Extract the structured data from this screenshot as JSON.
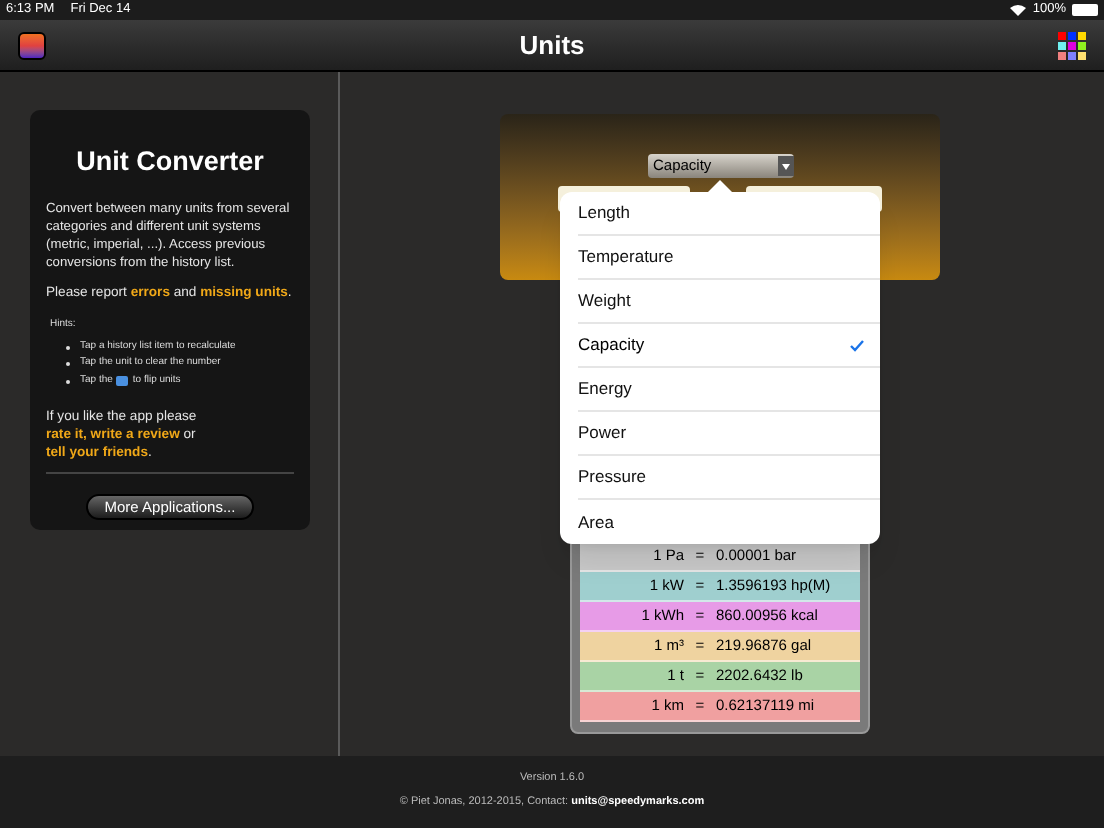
{
  "status_bar": {
    "time": "6:13 PM",
    "date": "Fri Dec 14",
    "battery": "100%"
  },
  "nav_bar": {
    "title": "Units"
  },
  "info_card": {
    "title": "Unit Converter",
    "intro": "Convert between many units from several categories and different unit systems (metric, imperial, ...). Access previous conversions from the history list.",
    "report": [
      {
        "kind": "text",
        "text": "Please report"
      },
      {
        "kind": "link",
        "text": "errors"
      },
      {
        "kind": "text",
        "text": "and"
      },
      {
        "kind": "link",
        "text": "missing units"
      },
      {
        "kind": "text",
        "text": "."
      }
    ],
    "hints_title": "Hints:",
    "hints": [
      {
        "kind": "text",
        "text": "Tap a history list item to recalculate"
      },
      {
        "kind": "text",
        "text": "Tap the unit to clear the number"
      },
      {
        "kind": "with-icon",
        "text": "Tap the",
        "text_after": "to flip units"
      }
    ],
    "rate": [
      {
        "kind": "text",
        "text": "If you like the app please"
      },
      {
        "kind": "link",
        "text": "rate it, write a review"
      },
      {
        "kind": "text",
        "text": "or"
      },
      {
        "kind": "link",
        "text": "tell your friends"
      },
      {
        "kind": "text",
        "text": "."
      }
    ],
    "button": "More Applications..."
  },
  "converter": {
    "category": "Capacity"
  },
  "category_menu": [
    {
      "label": "Length",
      "selected": false
    },
    {
      "label": "Temperature",
      "selected": false
    },
    {
      "label": "Weight",
      "selected": false
    },
    {
      "label": "Capacity",
      "selected": true
    },
    {
      "label": "Energy",
      "selected": false
    },
    {
      "label": "Power",
      "selected": false
    },
    {
      "label": "Pressure",
      "selected": false
    },
    {
      "label": "Area",
      "selected": false
    }
  ],
  "history": [
    {
      "from": "1 Pa",
      "sign": "=",
      "to": "0.00001 bar",
      "color": "#c8c8c8"
    },
    {
      "from": "1 kW",
      "sign": "=",
      "to": "1.3596193 hp(M)",
      "color": "#9fcfcf"
    },
    {
      "from": "1 kWh",
      "sign": "=",
      "to": "860.00956 kcal",
      "color": "#e79be7"
    },
    {
      "from": "1 m³",
      "sign": "=",
      "to": "219.96876 gal",
      "color": "#efd3a0"
    },
    {
      "from": "1 t",
      "sign": "=",
      "to": "2202.6432 lb",
      "color": "#a9d3a5"
    },
    {
      "from": "1 km",
      "sign": "=",
      "to": "0.62137119 mi",
      "color": "#f0a0a0"
    }
  ],
  "footer": {
    "version": "Version 1.6.0",
    "copyright": "© Piet Jonas, 2012-2015, Contact:",
    "email": "units@speedymarks.com"
  }
}
